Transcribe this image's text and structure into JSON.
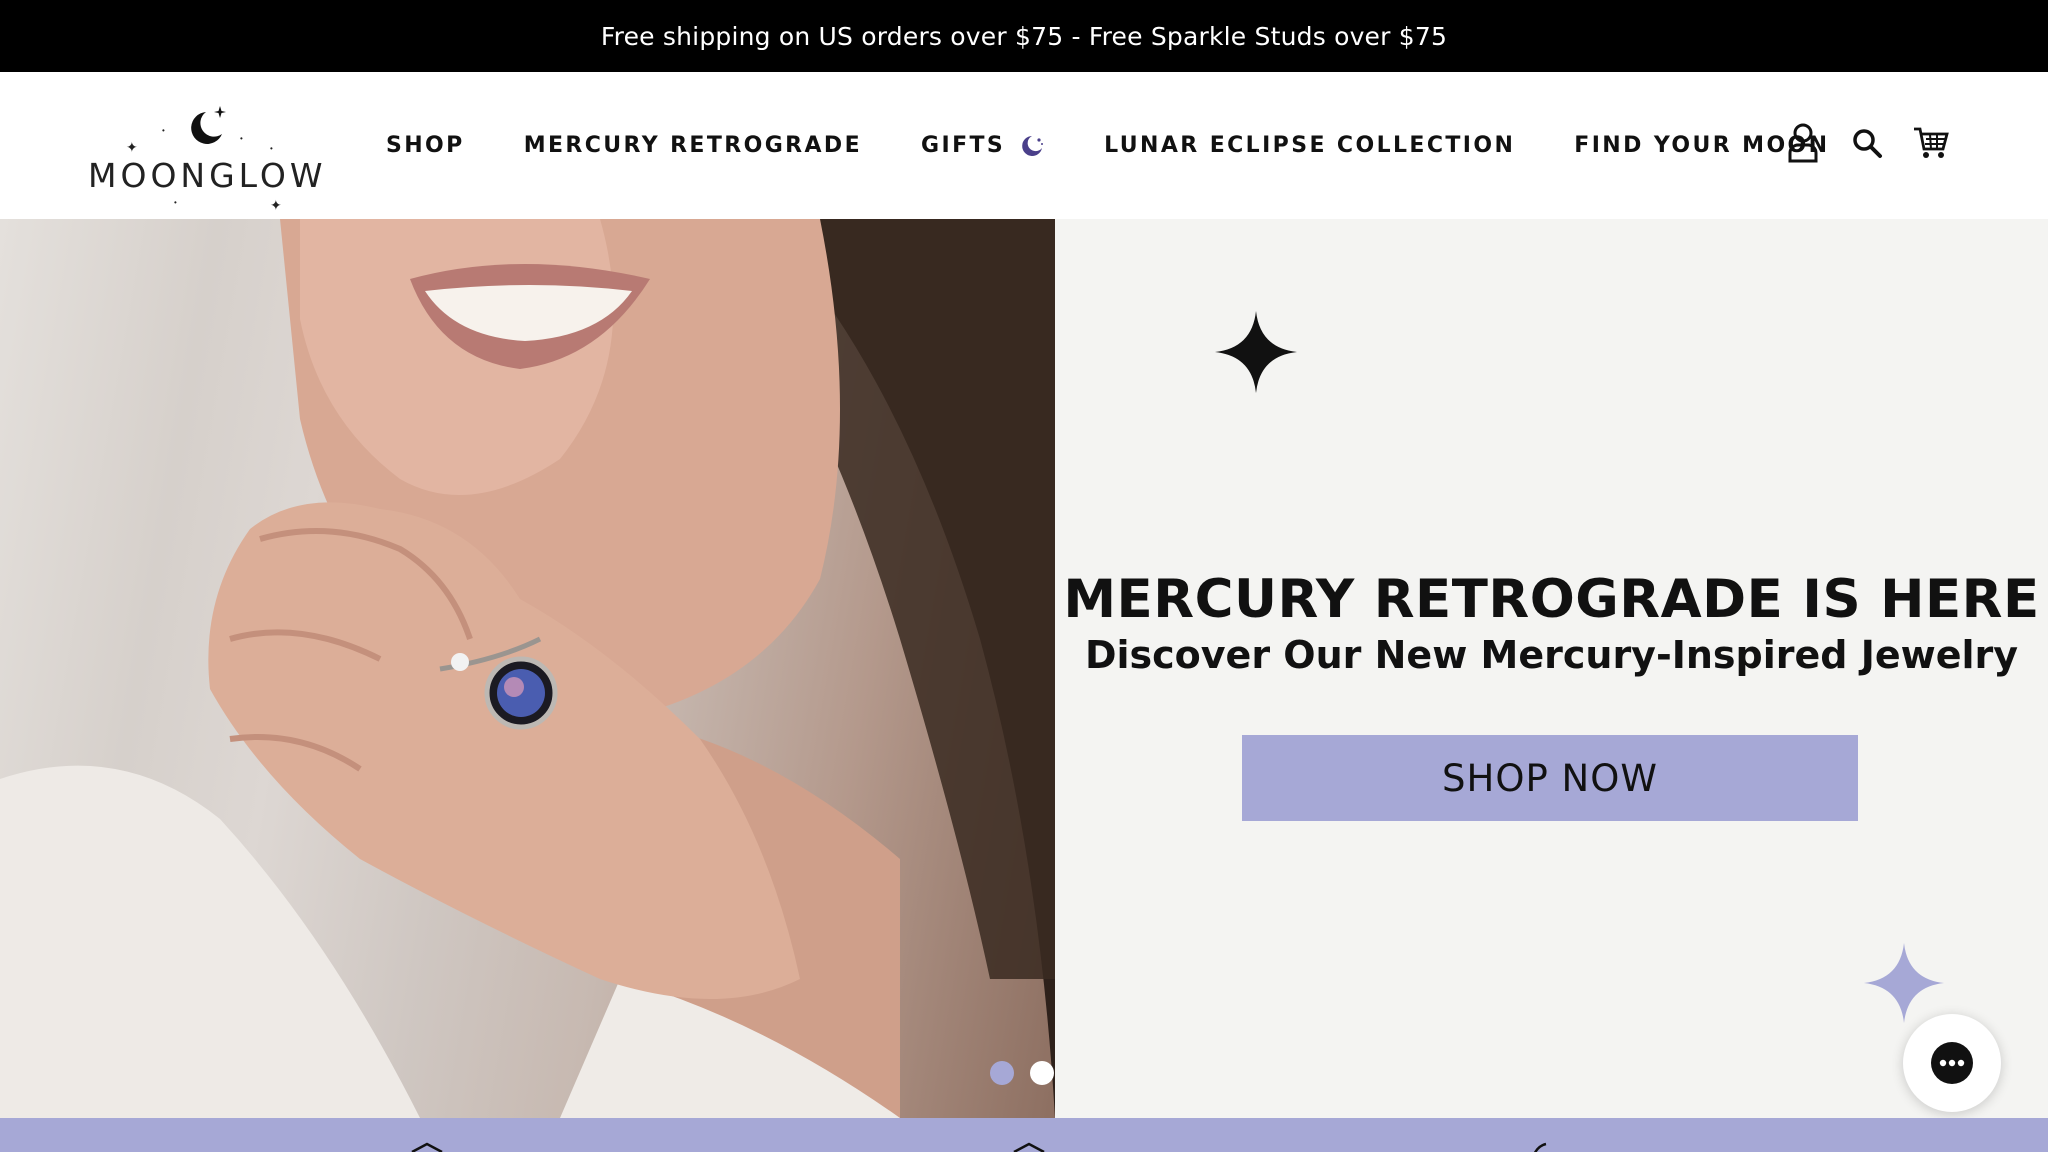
{
  "announcement": {
    "text": "Free shipping on US orders over $75 - Free Sparkle Studs over $75"
  },
  "brand": {
    "name": "MOONGLOW",
    "accent": "#a6a8d6",
    "crescent_color": "#4a3f8a"
  },
  "nav": {
    "items": [
      {
        "label": "SHOP"
      },
      {
        "label": "MERCURY RETROGRADE"
      },
      {
        "label": "GIFTS",
        "icon": "crescent-moon-icon"
      },
      {
        "label": "LUNAR ECLIPSE COLLECTION"
      },
      {
        "label": "FIND YOUR MOON"
      }
    ]
  },
  "header_icons": [
    "account-icon",
    "search-icon",
    "cart-icon"
  ],
  "hero": {
    "title": "MERCURY RETROGRADE IS HERE",
    "subtitle": "Discover Our New Mercury-Inspired Jewelry",
    "cta": "SHOP NOW",
    "image": "smiling woman wearing moon ring",
    "slides": {
      "count": 2,
      "active": 1
    }
  },
  "chat": {
    "icon": "chat-bubble-icon"
  },
  "bottom_bar": {
    "color": "#a6a8d6"
  }
}
